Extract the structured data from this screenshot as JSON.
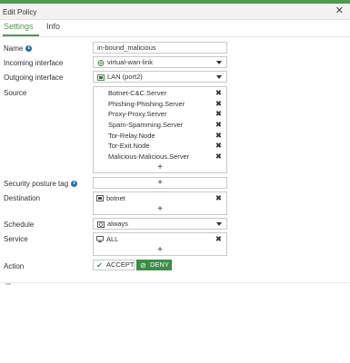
{
  "dialog": {
    "title": "Edit Policy",
    "close_glyph": "✕"
  },
  "tabs": [
    {
      "label": "Settings",
      "active": true
    },
    {
      "label": "Info",
      "active": false
    }
  ],
  "fields": {
    "name": {
      "label": "Name",
      "value": "in-bound_malicious"
    },
    "incoming": {
      "label": "Incoming interface",
      "value": "virtual-wan-link",
      "icon": "wan-icon"
    },
    "outgoing": {
      "label": "Outgoing interface",
      "value": "LAN (port2)",
      "icon": "port-icon"
    },
    "source": {
      "label": "Source",
      "items": [
        "Botnet-C&C.Server",
        "Phishing-Phishing.Server",
        "Proxy-Proxy.Server",
        "Spam-Spamming.Server",
        "Tor-Relay.Node",
        "Tor-Exit.Node",
        "Malicious-Malicious.Server"
      ]
    },
    "posture": {
      "label": "Security posture tag"
    },
    "destination": {
      "label": "Destination",
      "items": [
        "botnet"
      ]
    },
    "schedule": {
      "label": "Schedule",
      "value": "always",
      "icon": "schedule-icon"
    },
    "service": {
      "label": "Service",
      "items": [
        "ALL"
      ]
    },
    "action": {
      "label": "Action",
      "accept_label": "ACCEPT",
      "deny_label": "DENY",
      "selected": "DENY"
    }
  },
  "glyphs": {
    "plus": "+",
    "remove": "✖",
    "check": "✔",
    "deny": "⊘"
  },
  "colors": {
    "accent": "#4e9a4f",
    "deny_bg": "#3a8f46",
    "info_icon": "#1f6fb5"
  }
}
